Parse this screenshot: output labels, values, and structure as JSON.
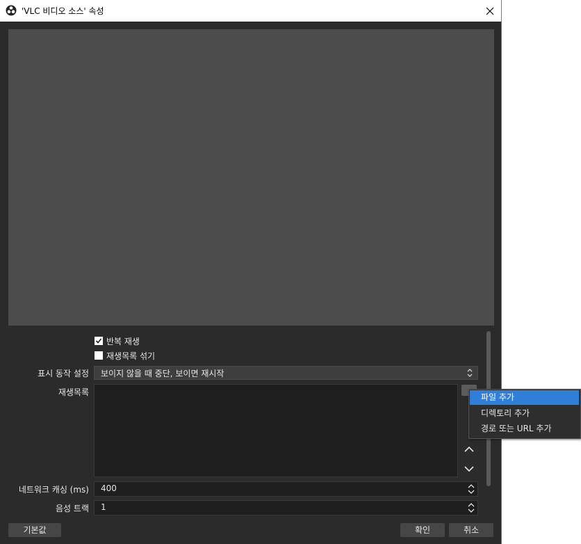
{
  "window": {
    "title": "'VLC 비디오 소스' 속성"
  },
  "options": {
    "loop_label": "반복 재생",
    "loop_checked": true,
    "shuffle_label": "재생목록 섞기",
    "shuffle_checked": false
  },
  "visibility": {
    "label": "표시 동작 설정",
    "value": "보이지 않을 때 중단, 보이면 재시작"
  },
  "playlist": {
    "label": "재생목록",
    "items": []
  },
  "network_caching": {
    "label": "네트워크 캐싱 (ms)",
    "value": "400"
  },
  "audio_track": {
    "label": "음성 트랙",
    "value": "1"
  },
  "buttons": {
    "defaults": "기본값",
    "ok": "확인",
    "cancel": "취소"
  },
  "context_menu": {
    "items": [
      {
        "label": "파일 추가",
        "active": true
      },
      {
        "label": "디렉토리 추가",
        "active": false
      },
      {
        "label": "경로 또는 URL 추가",
        "active": false
      }
    ]
  },
  "icons": {
    "app": "obs-logo-icon",
    "close": "close-icon",
    "move_up": "chevron-up-icon",
    "move_down": "chevron-down-icon",
    "combo": "updown-arrows-icon"
  },
  "colors": {
    "panel_bg": "#2b2b2b",
    "preview_bg": "#4c4c4c",
    "field_bg": "#1e1e1e",
    "menu_highlight": "#2f7ed8"
  }
}
